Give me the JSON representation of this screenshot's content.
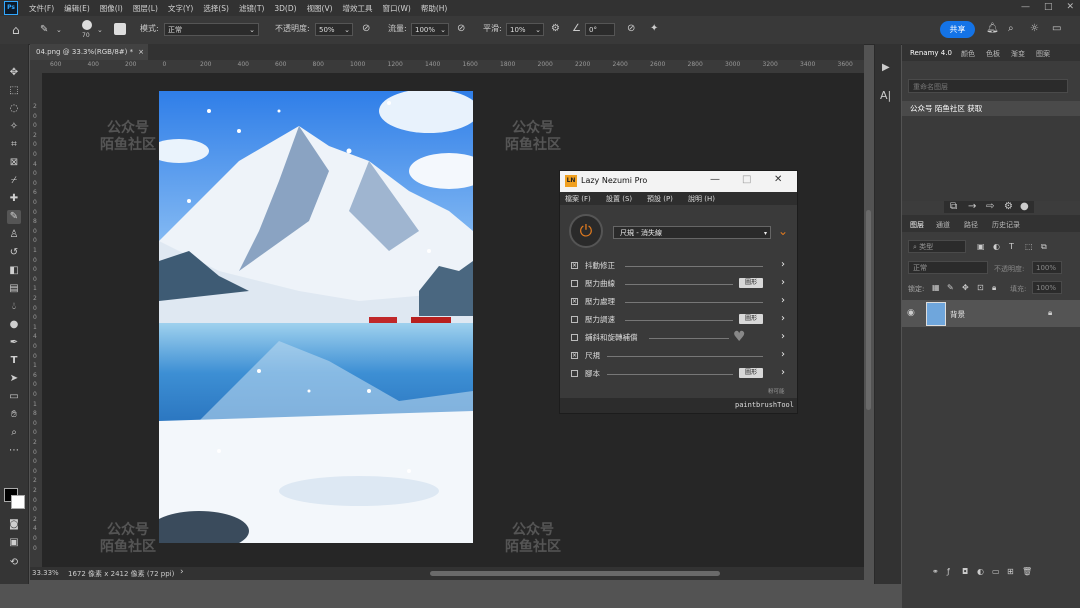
{
  "menubar": {
    "logo": "Ps",
    "items": [
      "文件(F)",
      "编辑(E)",
      "图像(I)",
      "图层(L)",
      "文字(Y)",
      "选择(S)",
      "滤镜(T)",
      "3D(D)",
      "视图(V)",
      "增效工具",
      "窗口(W)",
      "帮助(H)"
    ]
  },
  "options": {
    "brush_size": "70",
    "mode_label": "模式:",
    "mode_value": "正常",
    "opacity_label": "不透明度:",
    "opacity_value": "50%",
    "flow_label": "流量:",
    "flow_value": "100%",
    "smoothing_label": "平滑:",
    "smoothing_value": "10%",
    "angle_value": "0°",
    "share_label": "共享"
  },
  "document": {
    "tab_label": "04.png @ 33.3%(RGB/8#) *",
    "close": "×"
  },
  "ruler": {
    "h_ticks": [
      "600",
      "400",
      "200",
      "0",
      "200",
      "400",
      "600",
      "800",
      "1000",
      "1200",
      "1400",
      "1600",
      "1800",
      "2000",
      "2200",
      "2400",
      "2600",
      "2800",
      "3000",
      "3200",
      "3400",
      "3600"
    ],
    "v_ticks": [
      "2",
      "0",
      "0",
      "2",
      "0",
      "0",
      "4",
      "0",
      "0",
      "6",
      "0",
      "0",
      "8",
      "0",
      "0",
      "1",
      "0",
      "0",
      "0",
      "1",
      "2",
      "0",
      "0",
      "1",
      "4",
      "0",
      "0",
      "1",
      "6",
      "0",
      "0",
      "1",
      "8",
      "0",
      "0",
      "2",
      "0",
      "0",
      "0",
      "2",
      "2",
      "0",
      "0",
      "2",
      "4",
      "0",
      "0"
    ]
  },
  "status": {
    "zoom": "33.33%",
    "info": "1672 像素 x 2412 像素 (72 ppi)"
  },
  "watermark": {
    "line1": "公众号",
    "line2": "陌鱼社区"
  },
  "lazy_nezumi": {
    "logo": "LN",
    "title": "Lazy Nezumi Pro",
    "menu": [
      "檔案 (F)",
      "設置 (S)",
      "預設 (P)",
      "說明 (H)"
    ],
    "preset": "尺規 - 消失線",
    "rows": [
      {
        "label": "抖動修正",
        "checked": true,
        "button": ""
      },
      {
        "label": "壓力曲線",
        "checked": false,
        "button": "圖形"
      },
      {
        "label": "壓力處理",
        "checked": true,
        "button": ""
      },
      {
        "label": "壓力調速",
        "checked": false,
        "button": "圖形"
      },
      {
        "label": "鋪斜和旋轉補償",
        "checked": false,
        "button": ""
      },
      {
        "label": "尺規",
        "checked": true,
        "button": ""
      },
      {
        "label": "腳本",
        "checked": false,
        "button": "圖形"
      }
    ],
    "footer_small": "粉可能",
    "footer_tool": "paintbrushTool"
  },
  "right_panel": {
    "top_tabs": [
      "Renamy 4.0",
      "颜色",
      "色板",
      "渐变",
      "图案"
    ],
    "rename_placeholder": "重命名图层",
    "rename_result": "公众号 陌鱼社区 获取",
    "layer_tabs": [
      "图层",
      "通道",
      "路径",
      "历史记录"
    ],
    "kind_label": "类型",
    "blend_mode": "正常",
    "opacity_label": "不透明度:",
    "opacity_value": "100%",
    "lock_label": "锁定:",
    "fill_label": "填充:",
    "fill_value": "100%",
    "layer_name": "背景"
  },
  "colors": {
    "accent": "#1473e6",
    "ln_orange": "#e07a1f",
    "canvas_bg": "#262626",
    "panel_bg": "#3c3c3c"
  }
}
